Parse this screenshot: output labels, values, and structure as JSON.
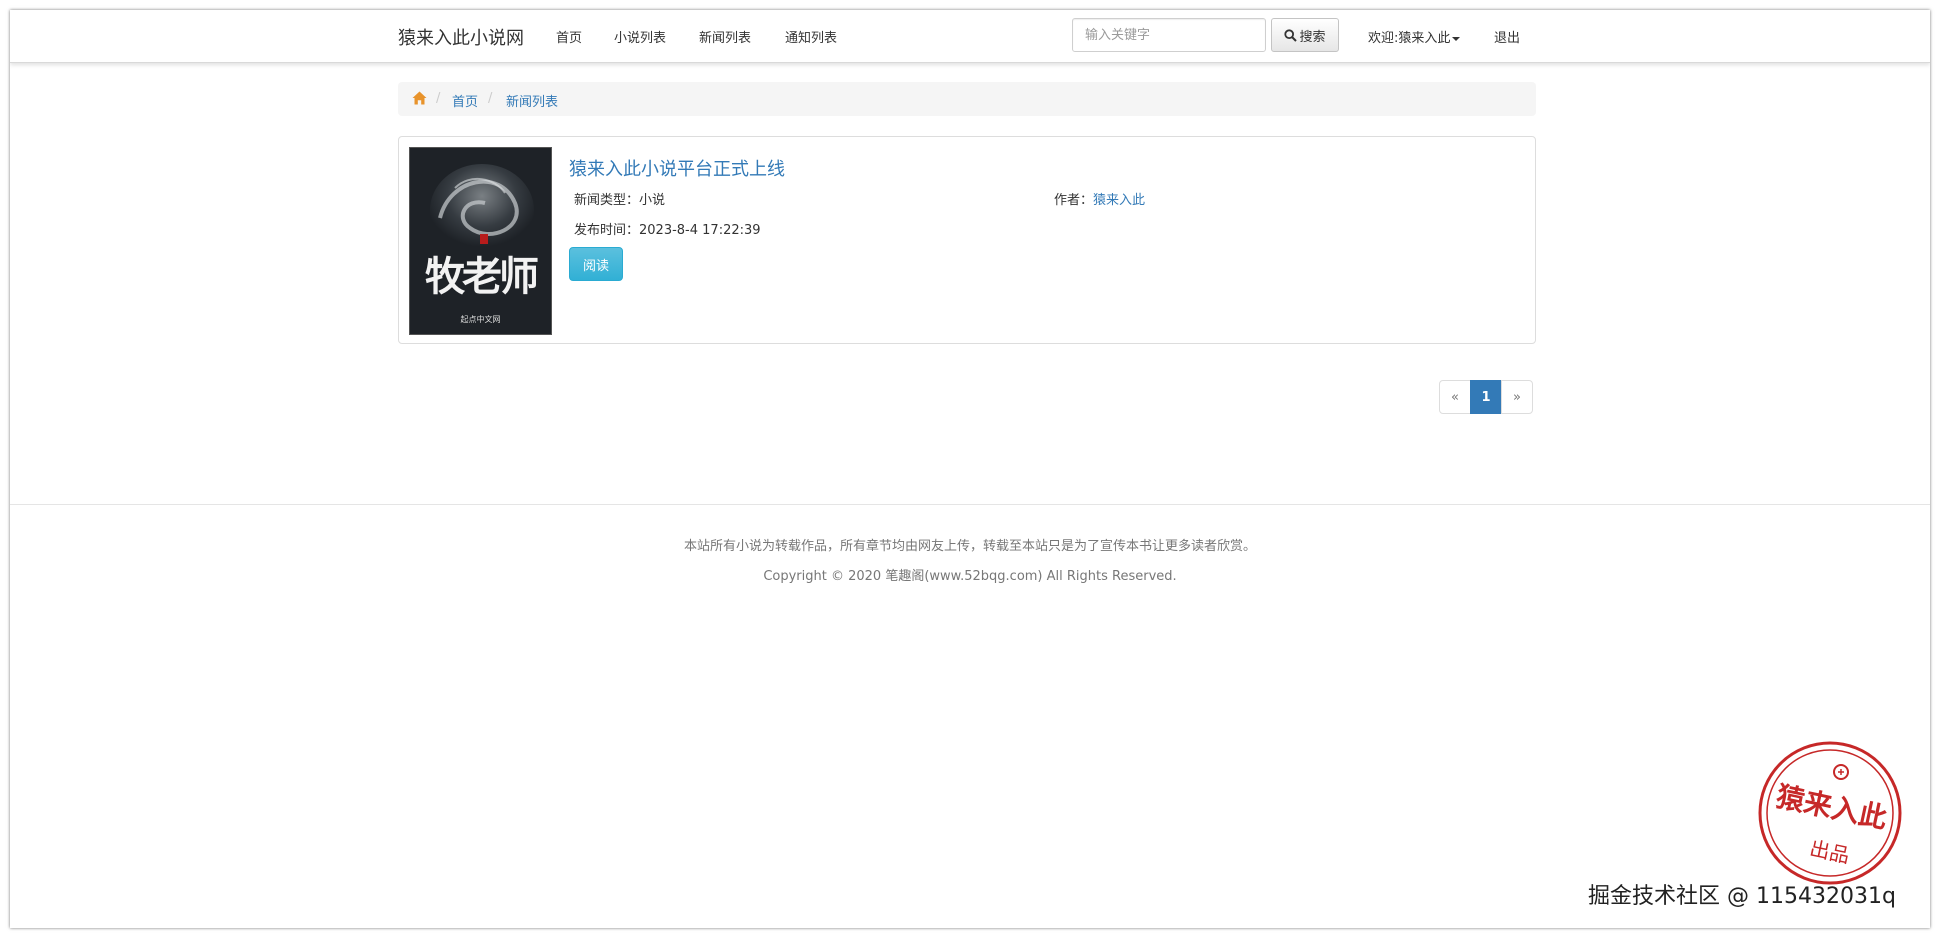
{
  "navbar": {
    "brand": "猿来入此小说网",
    "links": [
      "首页",
      "小说列表",
      "新闻列表",
      "通知列表"
    ],
    "search": {
      "placeholder": "输入关键字",
      "button": "搜索"
    },
    "welcome": "欢迎:猿来入此",
    "logout": "退出"
  },
  "breadcrumb": {
    "items": [
      "首页",
      "新闻列表"
    ]
  },
  "news": {
    "title": "猿来入此小说平台正式上线",
    "type_label": "新闻类型：",
    "type_value": "小说",
    "author_label": "作者：",
    "author_value": "猿来入此",
    "time_label": "发布时间：",
    "time_value": "2023-8-4 17:22:39",
    "read_button": "阅读",
    "cover": {
      "title": "牧老师",
      "publisher": "起点中文网"
    }
  },
  "pagination": {
    "prev": "«",
    "current": "1",
    "next": "»"
  },
  "footer": {
    "line1": "本站所有小说为转载作品，所有章节均由网友上传，转载至本站只是为了宣传本书让更多读者欣赏。",
    "line2": "Copyright © 2020 笔趣阁(www.52bqg.com) All Rights Reserved."
  },
  "stamp": {
    "main": "猿来入此",
    "sub": "出品"
  },
  "watermark": "掘金技术社区 @ 115432031q",
  "colors": {
    "link": "#337ab7",
    "info_button": "#5bc0de",
    "stamp_red": "#c62828"
  },
  "icons": [
    "home-icon",
    "search-icon",
    "caret-down-icon"
  ]
}
